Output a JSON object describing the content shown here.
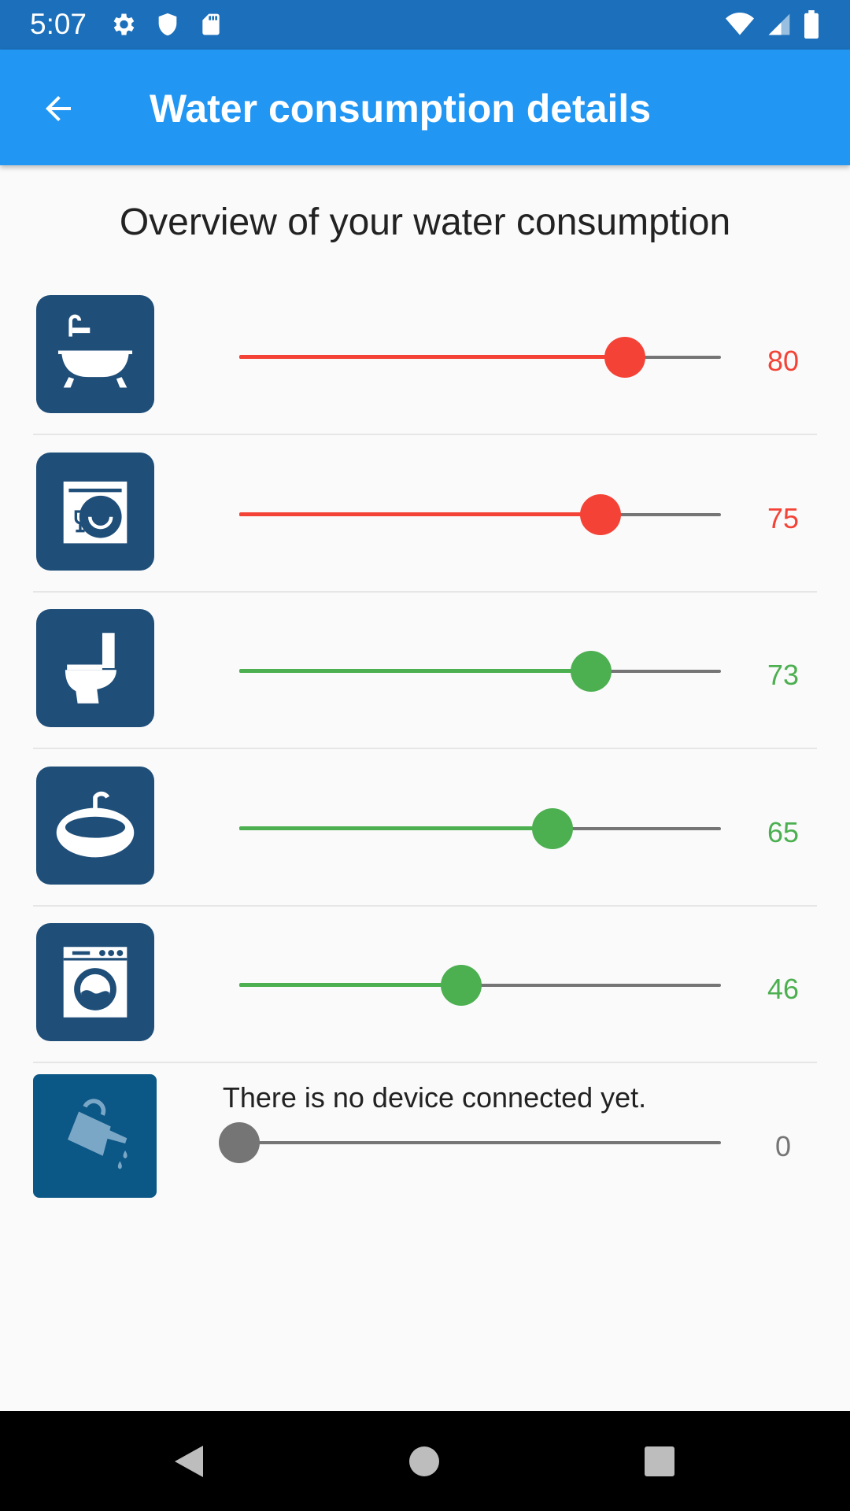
{
  "status_bar": {
    "time": "5:07"
  },
  "app_bar": {
    "title": "Water consumption details"
  },
  "overview_title": "Overview of your water consumption",
  "colors": {
    "high": "#f44336",
    "ok": "#4caf50",
    "none": "#757575",
    "app_bar": "#2196f3",
    "status_bar": "#1c6fba",
    "icon_bg": "#1f4e79"
  },
  "devices": [
    {
      "icon": "bathtub-icon",
      "value": "80",
      "level": 0.8,
      "status": "high"
    },
    {
      "icon": "dishwasher-icon",
      "value": "75",
      "level": 0.75,
      "status": "high"
    },
    {
      "icon": "toilet-icon",
      "value": "73",
      "level": 0.73,
      "status": "ok"
    },
    {
      "icon": "sink-icon",
      "value": "65",
      "level": 0.65,
      "status": "ok"
    },
    {
      "icon": "washing-machine-icon",
      "value": "46",
      "level": 0.46,
      "status": "ok"
    },
    {
      "icon": "watering-can-icon",
      "value": "0",
      "level": 0,
      "status": "none",
      "message": "There is no device connected yet."
    }
  ]
}
